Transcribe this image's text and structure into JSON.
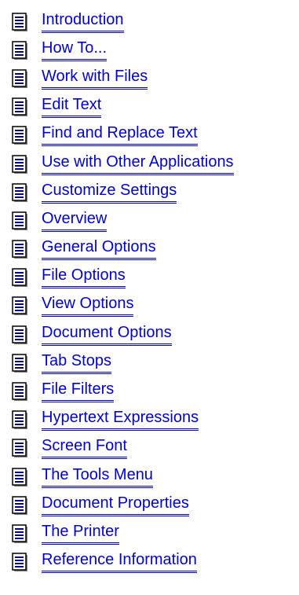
{
  "topics": [
    {
      "label": "Introduction",
      "icon": "document-icon"
    },
    {
      "label": "How To...",
      "icon": "document-icon"
    },
    {
      "label": "Work with Files",
      "icon": "document-icon"
    },
    {
      "label": "Edit Text",
      "icon": "document-icon"
    },
    {
      "label": "Find and Replace Text",
      "icon": "document-icon"
    },
    {
      "label": "Use with Other Applications",
      "icon": "document-icon"
    },
    {
      "label": "Customize Settings",
      "icon": "document-icon"
    },
    {
      "label": "Overview",
      "icon": "document-icon"
    },
    {
      "label": "General Options",
      "icon": "document-icon"
    },
    {
      "label": "File Options",
      "icon": "document-icon"
    },
    {
      "label": "View Options",
      "icon": "document-icon"
    },
    {
      "label": "Document Options",
      "icon": "document-icon"
    },
    {
      "label": "Tab Stops",
      "icon": "document-icon"
    },
    {
      "label": "File Filters",
      "icon": "document-icon"
    },
    {
      "label": "Hypertext Expressions",
      "icon": "document-icon"
    },
    {
      "label": "Screen Font",
      "icon": "document-icon"
    },
    {
      "label": "The Tools Menu",
      "icon": "document-icon"
    },
    {
      "label": "Document Properties",
      "icon": "document-icon"
    },
    {
      "label": "The Printer",
      "icon": "document-icon"
    },
    {
      "label": "Reference Information",
      "icon": "document-icon"
    }
  ],
  "colors": {
    "link": "#0000cc",
    "icon_page": "#ffffff",
    "icon_border": "#000000",
    "icon_lines": "#000080",
    "icon_shadow": "#808080"
  }
}
